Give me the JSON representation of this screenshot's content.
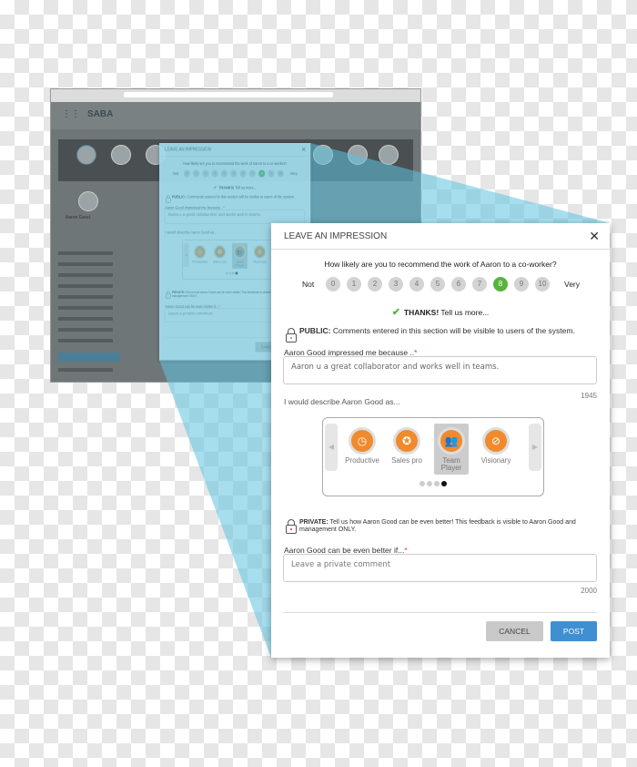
{
  "browser": {
    "logo": "SABA",
    "active_profile_name": "Aaron Good"
  },
  "dialog": {
    "title": "LEAVE AN IMPRESSION",
    "close_icon": "close-icon",
    "question": "How likely are you to recommend the work of Aaron to a co-worker?",
    "scale_low": "Not",
    "scale_high": "Very",
    "scale": [
      "0",
      "1",
      "2",
      "3",
      "4",
      "5",
      "6",
      "7",
      "8",
      "9",
      "10"
    ],
    "selected_score": 8,
    "thanks_bold": "THANKS!",
    "thanks_rest": "Tell us more...",
    "public_bold": "PUBLIC:",
    "public_text": "Comments entered in this section will be visible to users of the system.",
    "public_label": "Aaron Good impressed me because ..",
    "public_value": "Aaron u a great collaborator and works well in teams.",
    "public_count": "1945",
    "describe_label": "I would describe Aaron Good as...",
    "badges": [
      {
        "label": "Productive",
        "icon": "clock-icon",
        "selected": false
      },
      {
        "label": "Sales pro",
        "icon": "medal-icon",
        "selected": false
      },
      {
        "label": "Team Player",
        "icon": "team-icon",
        "selected": true
      },
      {
        "label": "Visionary",
        "icon": "compass-icon",
        "selected": false
      }
    ],
    "carousel_page": 4,
    "carousel_pages": 4,
    "private_bold": "PRIVATE:",
    "private_text": "Tell us how Aaron Good can be even better! This feedback is visible to Aaron Good and management ONLY.",
    "private_label": "Aaron Good can be even better if...",
    "required_mark": "*",
    "private_placeholder": "Leave a private comment",
    "private_count": "2000",
    "cancel_label": "CANCEL",
    "post_label": "POST"
  },
  "colors": {
    "selected_score": "#58b43a",
    "post": "#3f8fd2",
    "badge": "#f08a2c",
    "projection": "#5ec3e0"
  }
}
